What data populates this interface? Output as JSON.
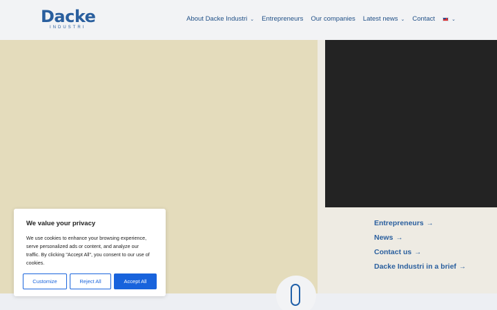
{
  "header": {
    "logo_word": "Dacke",
    "logo_sub": "INDUSTRI",
    "nav": [
      {
        "label": "About Dacke Industri"
      },
      {
        "label": "Entrepreneurs"
      },
      {
        "label": "Our companies"
      },
      {
        "label": "Latest news"
      },
      {
        "label": "Contact"
      }
    ],
    "language_icon": "uk-flag-icon"
  },
  "quick_links": [
    {
      "label": "Entrepreneurs"
    },
    {
      "label": "News"
    },
    {
      "label": "Contact us"
    },
    {
      "label": "Dacke Industri in a brief"
    }
  ],
  "cookie_banner": {
    "title": "We value your privacy",
    "text": "We use cookies to enhance your browsing experience, serve personalized ads or content, and analyze our traffic. By clicking \"Accept All\", you consent to our use of cookies.",
    "customize": "Customize",
    "reject": "Reject All",
    "accept": "Accept All"
  },
  "colors": {
    "brand": "#2a5f9e",
    "beige_panel": "#e4dcbc",
    "dark_panel": "#232323",
    "button_blue": "#1863dc"
  }
}
